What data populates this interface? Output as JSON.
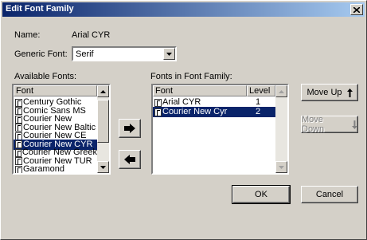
{
  "window": {
    "title": "Edit Font Family"
  },
  "fields": {
    "name_label": "Name:",
    "name_value": "Arial CYR",
    "generic_label": "Generic Font:",
    "generic_value": "Serif"
  },
  "available": {
    "label": "Available Fonts:",
    "header": "Font",
    "items": [
      "Century Gothic",
      "Comic Sans MS",
      "Courier New",
      "Courier New Baltic",
      "Courier New CE",
      "Courier New CYR",
      "Courier New Greek",
      "Courier New TUR",
      "Garamond"
    ],
    "selected_index": 5
  },
  "family": {
    "label": "Fonts in Font Family:",
    "header_font": "Font",
    "header_level": "Level",
    "items": [
      {
        "font": "Arial CYR",
        "level": "1"
      },
      {
        "font": "Courier New Cyr",
        "level": "2"
      }
    ],
    "selected_index": 1
  },
  "buttons": {
    "move_up": "Move Up",
    "move_down": "Move Down",
    "ok": "OK",
    "cancel": "Cancel"
  },
  "colors": {
    "title_start": "#0a246a",
    "title_end": "#a6caf0",
    "selection": "#0a246a",
    "face": "#d4d0c8"
  }
}
